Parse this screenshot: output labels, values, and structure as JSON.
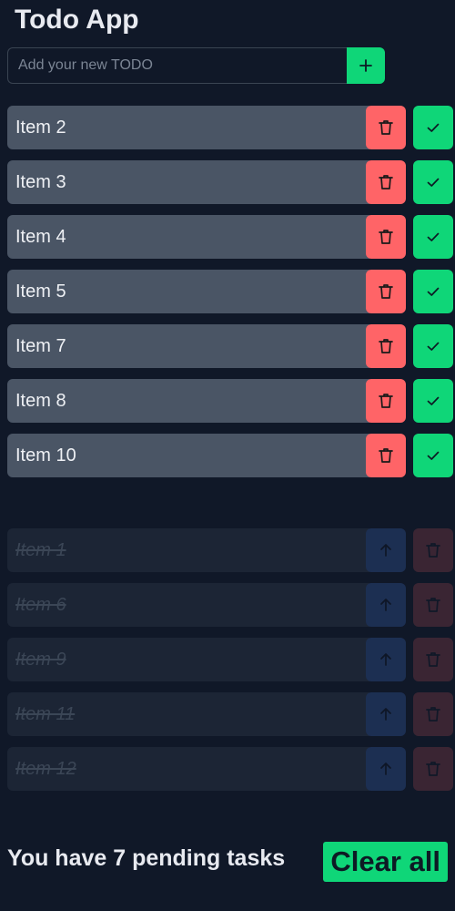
{
  "app": {
    "title": "Todo App"
  },
  "new_todo": {
    "placeholder": "Add your new TODO",
    "value": "",
    "add_icon": "plus-icon"
  },
  "pending_todos": [
    {
      "label": "Item 2",
      "delete_icon": "trash-icon",
      "complete_icon": "check-icon"
    },
    {
      "label": "Item 3",
      "delete_icon": "trash-icon",
      "complete_icon": "check-icon"
    },
    {
      "label": "Item 4",
      "delete_icon": "trash-icon",
      "complete_icon": "check-icon"
    },
    {
      "label": "Item 5",
      "delete_icon": "trash-icon",
      "complete_icon": "check-icon"
    },
    {
      "label": "Item 7",
      "delete_icon": "trash-icon",
      "complete_icon": "check-icon"
    },
    {
      "label": "Item 8",
      "delete_icon": "trash-icon",
      "complete_icon": "check-icon"
    },
    {
      "label": "Item 10",
      "delete_icon": "trash-icon",
      "complete_icon": "check-icon"
    }
  ],
  "completed_todos": [
    {
      "label": "Item 1",
      "restore_icon": "arrow-up-icon",
      "delete_icon": "trash-icon"
    },
    {
      "label": "Item 6",
      "restore_icon": "arrow-up-icon",
      "delete_icon": "trash-icon"
    },
    {
      "label": "Item 9",
      "restore_icon": "arrow-up-icon",
      "delete_icon": "trash-icon"
    },
    {
      "label": "Item 11",
      "restore_icon": "arrow-up-icon",
      "delete_icon": "trash-icon"
    },
    {
      "label": "Item 12",
      "restore_icon": "arrow-up-icon",
      "delete_icon": "trash-icon"
    }
  ],
  "footer": {
    "pending_text": "You have 7 pending tasks",
    "clear_label": "Clear all"
  },
  "colors": {
    "background": "#101828",
    "accent_green": "#0fd678",
    "delete_red": "#ff6467",
    "pending_row": "#4a5565",
    "completed_row": "#1c2535",
    "restore_blue": "#1c2f52",
    "delete_dim": "#3a2533"
  }
}
